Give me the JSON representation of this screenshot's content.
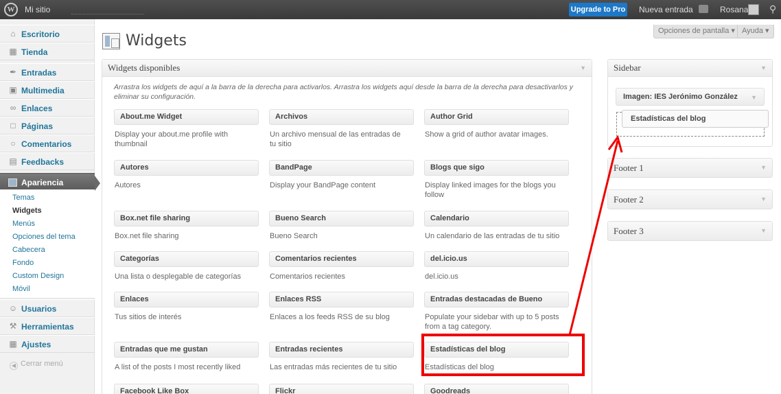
{
  "admin_bar": {
    "logo": "W",
    "site_name": "Mi sitio",
    "upgrade": "Upgrade to Pro",
    "new_entry": "Nueva entrada",
    "user": "Rosana",
    "search_icon": "search-icon"
  },
  "menu": {
    "items": [
      {
        "label": "Escritorio",
        "icon": "home-icon"
      },
      {
        "label": "Tienda",
        "icon": "cart-icon"
      },
      {
        "label": "Entradas",
        "icon": "pin-icon"
      },
      {
        "label": "Multimedia",
        "icon": "media-icon"
      },
      {
        "label": "Enlaces",
        "icon": "link-icon"
      },
      {
        "label": "Páginas",
        "icon": "page-icon"
      },
      {
        "label": "Comentarios",
        "icon": "comment-icon"
      },
      {
        "label": "Feedbacks",
        "icon": "feedback-icon"
      },
      {
        "label": "Apariencia",
        "icon": "appearance-icon"
      },
      {
        "label": "Usuarios",
        "icon": "users-icon"
      },
      {
        "label": "Herramientas",
        "icon": "tools-icon"
      },
      {
        "label": "Ajustes",
        "icon": "settings-icon"
      }
    ],
    "submenu": [
      "Temas",
      "Widgets",
      "Menús",
      "Opciones del tema",
      "Cabecera",
      "Fondo",
      "Custom Design",
      "Móvil"
    ],
    "collapse": "Cerrar menú"
  },
  "header": {
    "title": "Widgets",
    "screen_options": "Opciones de pantalla",
    "help": "Ayuda"
  },
  "available": {
    "title": "Widgets disponibles",
    "description": "Arrastra los widgets de aquí a la barra de la derecha para activarlos. Arrastra los widgets aquí desde la barra de la derecha para desactivarlos y eliminar su configuración.",
    "widgets": [
      {
        "title": "About.me Widget",
        "desc": "Display your about.me profile with thumbnail"
      },
      {
        "title": "Archivos",
        "desc": "Un archivo mensual de las entradas de tu sitio"
      },
      {
        "title": "Author Grid",
        "desc": "Show a grid of author avatar images."
      },
      {
        "title": "Autores",
        "desc": "Autores"
      },
      {
        "title": "BandPage",
        "desc": "Display your BandPage content"
      },
      {
        "title": "Blogs que sigo",
        "desc": "Display linked images for the blogs you follow"
      },
      {
        "title": "Box.net file sharing",
        "desc": "Box.net file sharing"
      },
      {
        "title": "Bueno Search",
        "desc": "Bueno Search"
      },
      {
        "title": "Calendario",
        "desc": "Un calendario de las entradas de tu sitio"
      },
      {
        "title": "Categorías",
        "desc": "Una lista o desplegable de categorías"
      },
      {
        "title": "Comentarios recientes",
        "desc": "Comentarios recientes"
      },
      {
        "title": "del.icio.us",
        "desc": "del.icio.us"
      },
      {
        "title": "Enlaces",
        "desc": "Tus sitios de interés"
      },
      {
        "title": "Enlaces RSS",
        "desc": "Enlaces a los feeds RSS de su blog"
      },
      {
        "title": "Entradas destacadas de Bueno",
        "desc": "Populate your sidebar with up to 5 posts from a tag category."
      },
      {
        "title": "Entradas que me gustan",
        "desc": "A list of the posts I most recently liked"
      },
      {
        "title": "Entradas recientes",
        "desc": "Las entradas más recientes de tu sitio"
      },
      {
        "title": "Estadísticas del blog",
        "desc": "Estadísticas del blog"
      },
      {
        "title": "Facebook Like Box",
        "desc": ""
      },
      {
        "title": "Flickr",
        "desc": ""
      },
      {
        "title": "Goodreads",
        "desc": ""
      }
    ]
  },
  "sidebars": {
    "sidebar_title": "Sidebar",
    "sidebar_widgets": [
      "Imagen: IES Jerónimo González"
    ],
    "dragging_widget": "Estadísticas del blog",
    "footer1": "Footer 1",
    "footer2": "Footer 2",
    "footer3": "Footer 3"
  },
  "colors": {
    "accent": "#21759b",
    "upgrade": "#1e78c8",
    "annotation": "#ee0000"
  }
}
